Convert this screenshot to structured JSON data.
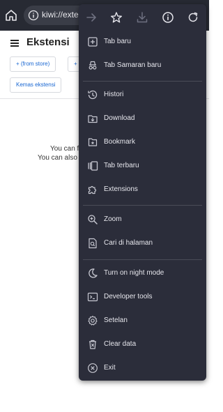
{
  "toolbar": {
    "url_text": "kiwi://extens"
  },
  "page": {
    "title": "Ekstensi",
    "chips": [
      "+ (from store)",
      "+",
      "Kemas ekstensi"
    ],
    "empty_line_1": "You can f",
    "empty_line_2": "You can also"
  },
  "menu": {
    "items": [
      {
        "label": "Tab baru",
        "icon": "new-tab-icon"
      },
      {
        "label": "Tab Samaran baru",
        "icon": "incognito-icon"
      },
      {
        "label": "Histori",
        "icon": "history-icon"
      },
      {
        "label": "Download",
        "icon": "download-icon"
      },
      {
        "label": "Bookmark",
        "icon": "bookmark-icon"
      },
      {
        "label": "Tab terbaru",
        "icon": "recent-tabs-icon"
      },
      {
        "label": "Extensions",
        "icon": "puzzle-icon"
      },
      {
        "label": "Zoom",
        "icon": "zoom-icon"
      },
      {
        "label": "Cari di halaman",
        "icon": "find-in-page-icon"
      },
      {
        "label": "Turn on night mode",
        "icon": "moon-icon"
      },
      {
        "label": "Developer tools",
        "icon": "terminal-icon"
      },
      {
        "label": "Setelan",
        "icon": "gear-icon"
      },
      {
        "label": "Clear data",
        "icon": "trash-icon"
      },
      {
        "label": "Exit",
        "icon": "close-circle-icon"
      }
    ]
  },
  "colors": {
    "menu_bg": "#2b2d3a",
    "topbar_bg": "#272a33",
    "link_blue": "#1967d2"
  }
}
